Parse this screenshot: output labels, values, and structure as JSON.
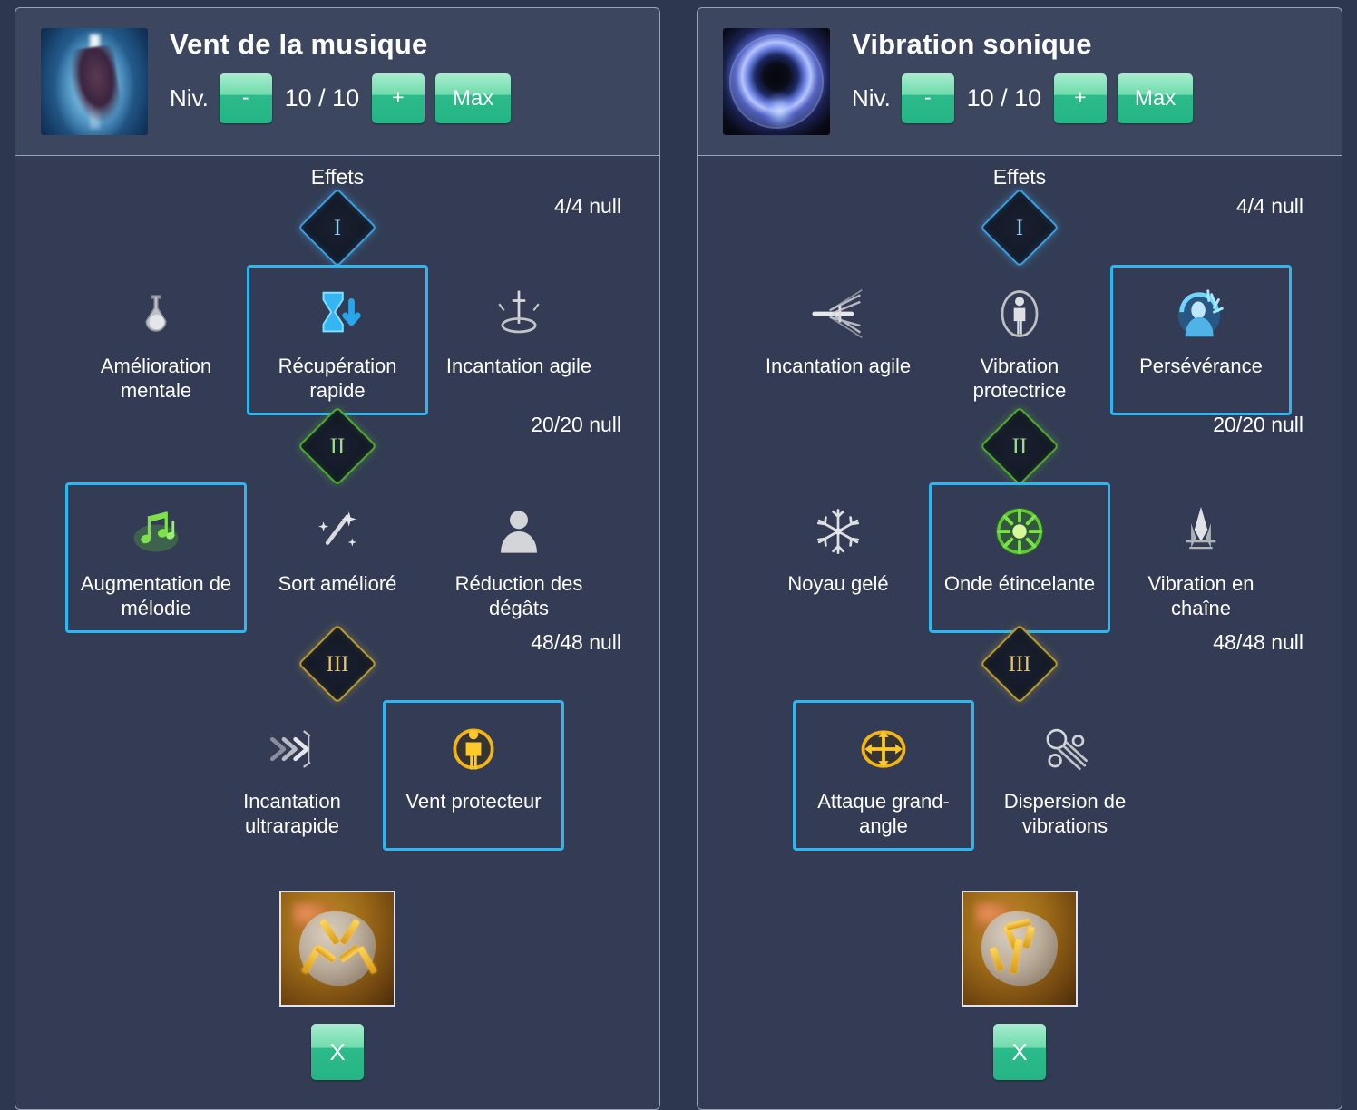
{
  "theme": {
    "page_bg": "#2e3750",
    "panel_header_bg": "#3c465f",
    "panel_body_bg": "#333c54",
    "panel_border": "#9aa3b4",
    "accent_selected": "#2cb8ee",
    "button_green": "#2cba8a",
    "tier1_color": "#3e9fe0",
    "tier2_color": "#52a832",
    "tier3_color": "#b79b33",
    "text_color": "#ffffff"
  },
  "panels": [
    {
      "title": "Vent de la musique",
      "icon_name": "skill-icon-wind-of-music",
      "level": {
        "label": "Niv.",
        "value": "10 / 10",
        "minus_label": "-",
        "plus_label": "+",
        "max_label": "Max"
      },
      "effects_label": "Effets",
      "tiers": [
        {
          "numeral": "I",
          "count": "4/4 null",
          "nodes": [
            {
              "label": "Amélioration mentale",
              "icon": "potion-flask-icon",
              "selected": false
            },
            {
              "label": "Récupération rapide",
              "icon": "hourglass-down-arrow-icon",
              "selected": true
            },
            {
              "label": "Incantation agile",
              "icon": "sword-swirl-icon",
              "selected": false
            }
          ]
        },
        {
          "numeral": "II",
          "count": "20/20 null",
          "nodes": [
            {
              "label": "Augmentation de mélodie",
              "icon": "music-notes-icon",
              "selected": true
            },
            {
              "label": "Sort amélioré",
              "icon": "magic-wand-sparkle-icon",
              "selected": false
            },
            {
              "label": "Réduction des dégâts",
              "icon": "person-bust-icon",
              "selected": false
            }
          ]
        },
        {
          "numeral": "III",
          "count": "48/48 null",
          "nodes": [
            {
              "label": "Incantation ultrarapide",
              "icon": "triple-chevron-speed-icon",
              "selected": false
            },
            {
              "label": "Vent protecteur",
              "icon": "golden-person-ring-icon",
              "selected": true
            }
          ]
        }
      ],
      "rune": {
        "icon": "rune-stone-othala-icon",
        "symbol": "X"
      },
      "close_button": {
        "label": "X"
      }
    },
    {
      "title": "Vibration sonique",
      "icon_name": "skill-icon-sonic-vibration",
      "level": {
        "label": "Niv.",
        "value": "10 / 10",
        "minus_label": "-",
        "plus_label": "+",
        "max_label": "Max"
      },
      "effects_label": "Effets",
      "tiers": [
        {
          "numeral": "I",
          "count": "4/4 null",
          "nodes": [
            {
              "label": "Incantation agile",
              "icon": "piercing-arrow-icon",
              "selected": false
            },
            {
              "label": "Vibration protectrice",
              "icon": "person-shield-ring-icon",
              "selected": false
            },
            {
              "label": "Persévérance",
              "icon": "blue-person-burst-icon",
              "selected": true
            }
          ]
        },
        {
          "numeral": "II",
          "count": "20/20 null",
          "nodes": [
            {
              "label": "Noyau gelé",
              "icon": "snowflake-icon",
              "selected": false
            },
            {
              "label": "Onde étincelante",
              "icon": "green-sunburst-icon",
              "selected": true
            },
            {
              "label": "Vibration en chaîne",
              "icon": "rising-spike-icon",
              "selected": false
            }
          ]
        },
        {
          "numeral": "III",
          "count": "48/48 null",
          "nodes": [
            {
              "label": "Attaque grand-angle",
              "icon": "four-way-arrows-icon",
              "selected": true
            },
            {
              "label": "Dispersion de vibrations",
              "icon": "scattering-orbs-icon",
              "selected": false
            }
          ]
        }
      ],
      "rune": {
        "icon": "rune-stone-lightning-icon",
        "symbol": "N"
      },
      "close_button": {
        "label": "X"
      }
    }
  ]
}
